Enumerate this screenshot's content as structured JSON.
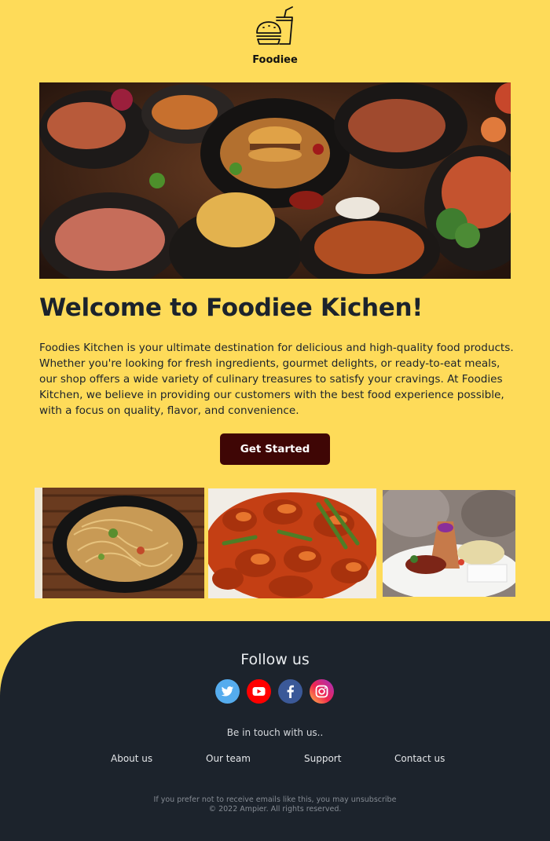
{
  "header": {
    "logo_icon": "burger-drink-icon",
    "brand": "Foodiee"
  },
  "hero": {
    "image": "food-feast-photo"
  },
  "main": {
    "title": "Welcome to Foodiee Kichen!",
    "intro": "Foodies Kitchen is your ultimate destination for delicious and high-quality food products. Whether you're looking for fresh ingredients, gourmet delights, or ready-to-eat meals, our shop offers a wide variety of culinary treasures to satisfy your cravings. At Foodies Kitchen, we believe in providing our customers with the best food experience possible, with a focus on quality, flavor, and convenience.",
    "cta_label": "Get Started"
  },
  "gallery": [
    {
      "image": "noodles-photo"
    },
    {
      "image": "glazed-chicken-photo"
    },
    {
      "image": "plated-dish-photo"
    }
  ],
  "footer": {
    "follow_title": "Follow us",
    "socials": [
      {
        "icon": "twitter-icon",
        "color": "#55acee"
      },
      {
        "icon": "youtube-icon",
        "color": "#ff0000"
      },
      {
        "icon": "facebook-icon",
        "color": "#3b5998"
      },
      {
        "icon": "instagram-icon",
        "color": "#e1306c"
      }
    ],
    "touch_text": "Be in touch with us..",
    "links": [
      "About us",
      "Our team",
      "Support",
      "Contact us"
    ],
    "unsubscribe": "If you prefer not to receive emails like this, you may unsubscribe",
    "copyright": "© 2022 Ampier. All rights reserved."
  },
  "colors": {
    "background": "#fedb59",
    "button": "#3f0605",
    "footer": "#1c232c"
  }
}
